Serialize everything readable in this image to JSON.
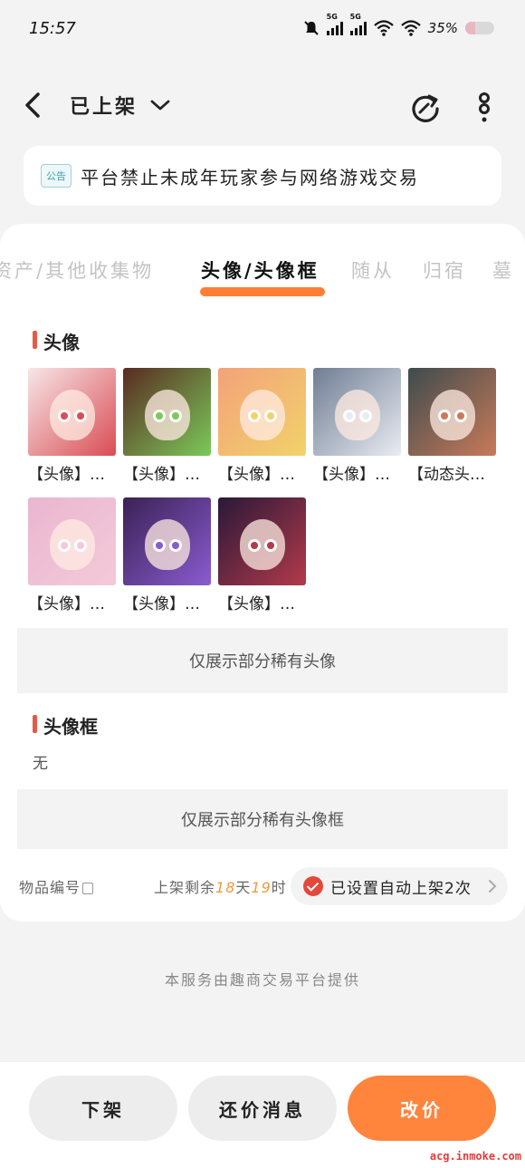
{
  "status": {
    "time": "15:57",
    "net1": "5G",
    "net2": "5G",
    "battery": "35%",
    "battery_level": 0.35
  },
  "nav": {
    "title": "已上架"
  },
  "notice": {
    "tag": "公告",
    "text": "平台禁止未成年玩家参与网络游戏交易"
  },
  "tabs": [
    {
      "label": "资产/其他收集物",
      "active": false
    },
    {
      "label": "头像/头像框",
      "active": true
    },
    {
      "label": "随从",
      "active": false
    },
    {
      "label": "归宿",
      "active": false
    },
    {
      "label": "墓",
      "active": false
    }
  ],
  "avatars_section": {
    "title": "头像",
    "items": [
      {
        "caption": "【头像】…",
        "colors": [
          "#f7e6e8",
          "#d94d54"
        ]
      },
      {
        "caption": "【头像】…",
        "colors": [
          "#5a2a22",
          "#7bc95a"
        ]
      },
      {
        "caption": "【头像】…",
        "colors": [
          "#f3a27a",
          "#f2d26a"
        ]
      },
      {
        "caption": "【头像】…",
        "colors": [
          "#6f7d93",
          "#e9ecf2"
        ]
      },
      {
        "caption": "【动态头…",
        "colors": [
          "#3e4b4d",
          "#c97a5a"
        ]
      },
      {
        "caption": "【头像】…",
        "colors": [
          "#e9b7d0",
          "#f4c9d9"
        ]
      },
      {
        "caption": "【头像】…",
        "colors": [
          "#3a2255",
          "#8a5bd0"
        ]
      },
      {
        "caption": "【头像】…",
        "colors": [
          "#2a1838",
          "#b23a4a"
        ]
      }
    ],
    "note": "仅展示部分稀有头像"
  },
  "frames_section": {
    "title": "头像框",
    "empty_text": "无",
    "note": "仅展示部分稀有头像框"
  },
  "meta": {
    "item_no_label": "物品编号",
    "remaining_prefix": "上架剩余",
    "days": "18",
    "days_unit": "天",
    "hours": "19",
    "hours_unit": "时",
    "auto_text": "已设置自动上架2次"
  },
  "footer_note": "本服务由趣商交易平台提供",
  "actions": {
    "delist": "下架",
    "counter_offer": "还价消息",
    "change_price": "改价"
  },
  "watermark": "acg.inmoke.com"
}
